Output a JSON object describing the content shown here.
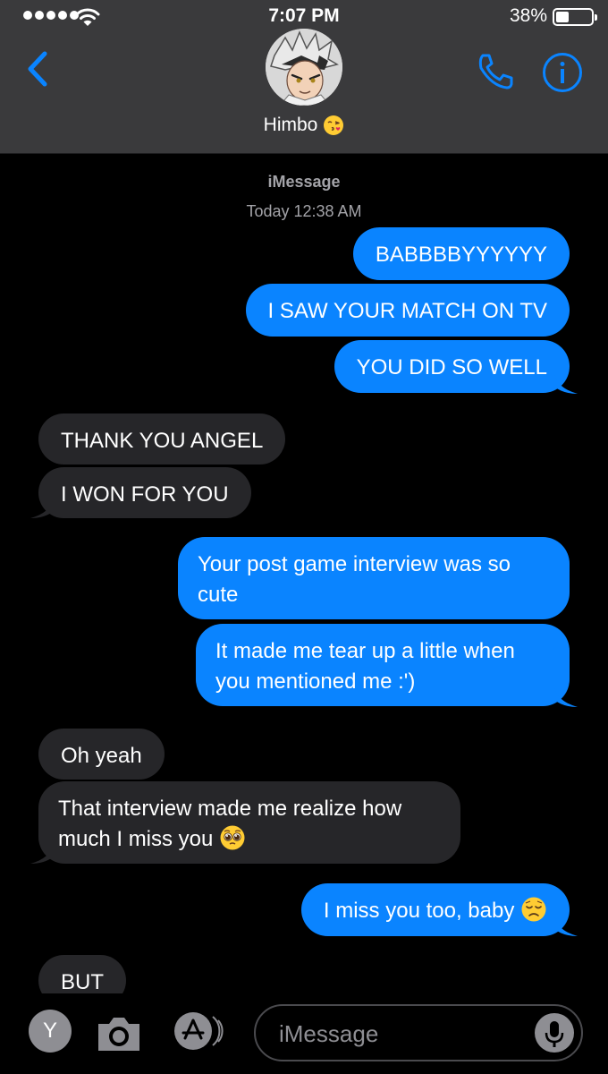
{
  "status_bar": {
    "time": "7:07 PM",
    "battery": "38%",
    "battery_level": 0.38
  },
  "header": {
    "contact_name": "Himbo",
    "name_emoji": "kissing-face-emoji"
  },
  "conversation": {
    "service": "iMessage",
    "timestamp": "Today 12:38 AM",
    "messages": [
      {
        "dir": "out",
        "text": "BABBBBYYYYYY"
      },
      {
        "dir": "out",
        "text": "I SAW YOUR MATCH ON TV"
      },
      {
        "dir": "out",
        "text": "YOU DID SO WELL"
      },
      {
        "dir": "in",
        "text": "THANK YOU ANGEL"
      },
      {
        "dir": "in",
        "text": "I WON FOR YOU"
      },
      {
        "dir": "out",
        "line1": "Your post game interview was so",
        "line2": "cute"
      },
      {
        "dir": "out",
        "line1": "It made me tear up a little when",
        "line2": "you mentioned me :')"
      },
      {
        "dir": "in",
        "text": "Oh yeah"
      },
      {
        "dir": "in",
        "line1": "That interview made me realize how",
        "line2": "much I miss you",
        "emoji": "pleading-face-emoji"
      },
      {
        "dir": "out",
        "text": "I miss you too, baby",
        "emoji": "disappointed-face-emoji"
      },
      {
        "dir": "in",
        "text": "BUT"
      }
    ]
  },
  "input_bar": {
    "placeholder": "iMessage",
    "app_label": "Y"
  },
  "colors": {
    "outgoing": "#0a84ff",
    "incoming": "#262629",
    "header": "#3a3a3c",
    "accent": "#0a84ff"
  }
}
